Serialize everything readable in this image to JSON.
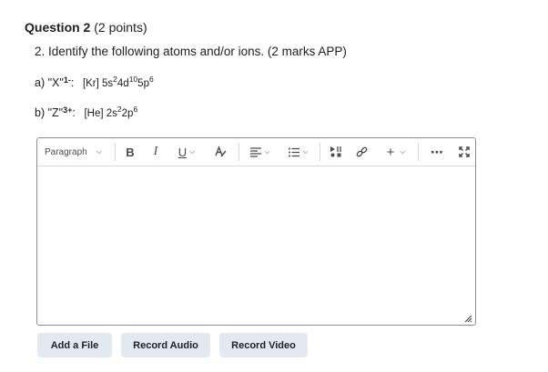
{
  "question": {
    "title": "Question 2",
    "points": "(2 points)",
    "prompt": "2. Identify the following atoms and/or ions. (2 marks APP)"
  },
  "items": [
    {
      "label_prefix": "a) \"X\"",
      "charge": "1-",
      "label_suffix": ":",
      "core": "[Kr] 5s",
      "p1": "2",
      "m1": "4d",
      "p2": "10",
      "m2": "5p",
      "p3": "6"
    },
    {
      "label_prefix": "b) \"Z\"",
      "charge": "3+",
      "label_suffix": ":",
      "core": "[He] 2s",
      "p1": "2",
      "m1": "2p",
      "p2": "6"
    }
  ],
  "toolbar": {
    "format_select": "Paragraph",
    "bold": "B",
    "italic": "I",
    "underline": "U",
    "insert_plus": "+",
    "more": "⋯"
  },
  "buttons": {
    "add_file": "Add a File",
    "record_audio": "Record Audio",
    "record_video": "Record Video"
  }
}
